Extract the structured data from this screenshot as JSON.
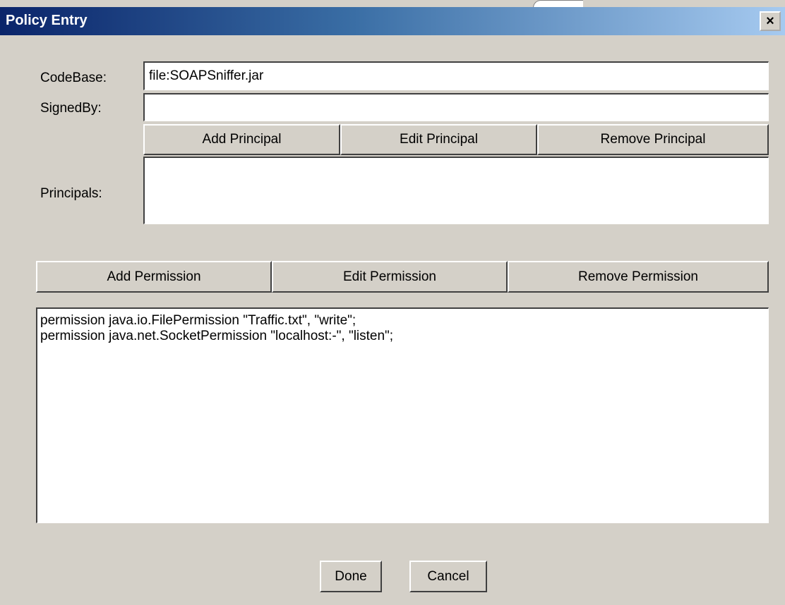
{
  "window": {
    "title": "Policy Entry",
    "close_glyph": "×"
  },
  "form": {
    "codebase_label": "CodeBase:",
    "codebase_value": "file:SOAPSniffer.jar",
    "signedby_label": "SignedBy:",
    "signedby_value": "",
    "principals_label": "Principals:"
  },
  "principal_buttons": {
    "add": "Add Principal",
    "edit": "Edit Principal",
    "remove": "Remove Principal"
  },
  "permission_buttons": {
    "add": "Add Permission",
    "edit": "Edit Permission",
    "remove": "Remove Permission"
  },
  "permissions": [
    "permission java.io.FilePermission \"Traffic.txt\", \"write\";",
    "permission java.net.SocketPermission \"localhost:-\", \"listen\";"
  ],
  "footer": {
    "done": "Done",
    "cancel": "Cancel"
  }
}
